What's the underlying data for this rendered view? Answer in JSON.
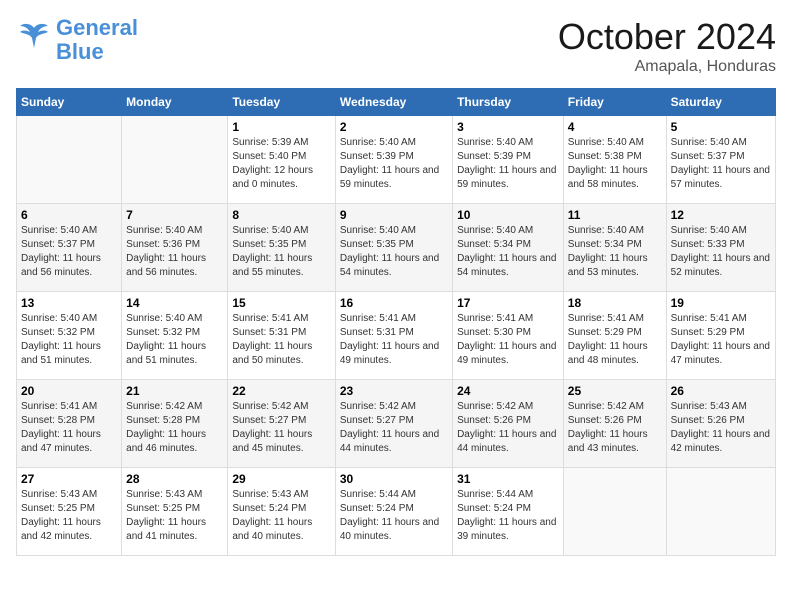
{
  "logo": {
    "line1": "General",
    "line2": "Blue"
  },
  "title": "October 2024",
  "location": "Amapala, Honduras",
  "days_of_week": [
    "Sunday",
    "Monday",
    "Tuesday",
    "Wednesday",
    "Thursday",
    "Friday",
    "Saturday"
  ],
  "weeks": [
    [
      {
        "day": "",
        "sunrise": "",
        "sunset": "",
        "daylight": ""
      },
      {
        "day": "",
        "sunrise": "",
        "sunset": "",
        "daylight": ""
      },
      {
        "day": "1",
        "sunrise": "Sunrise: 5:39 AM",
        "sunset": "Sunset: 5:40 PM",
        "daylight": "Daylight: 12 hours and 0 minutes."
      },
      {
        "day": "2",
        "sunrise": "Sunrise: 5:40 AM",
        "sunset": "Sunset: 5:39 PM",
        "daylight": "Daylight: 11 hours and 59 minutes."
      },
      {
        "day": "3",
        "sunrise": "Sunrise: 5:40 AM",
        "sunset": "Sunset: 5:39 PM",
        "daylight": "Daylight: 11 hours and 59 minutes."
      },
      {
        "day": "4",
        "sunrise": "Sunrise: 5:40 AM",
        "sunset": "Sunset: 5:38 PM",
        "daylight": "Daylight: 11 hours and 58 minutes."
      },
      {
        "day": "5",
        "sunrise": "Sunrise: 5:40 AM",
        "sunset": "Sunset: 5:37 PM",
        "daylight": "Daylight: 11 hours and 57 minutes."
      }
    ],
    [
      {
        "day": "6",
        "sunrise": "Sunrise: 5:40 AM",
        "sunset": "Sunset: 5:37 PM",
        "daylight": "Daylight: 11 hours and 56 minutes."
      },
      {
        "day": "7",
        "sunrise": "Sunrise: 5:40 AM",
        "sunset": "Sunset: 5:36 PM",
        "daylight": "Daylight: 11 hours and 56 minutes."
      },
      {
        "day": "8",
        "sunrise": "Sunrise: 5:40 AM",
        "sunset": "Sunset: 5:35 PM",
        "daylight": "Daylight: 11 hours and 55 minutes."
      },
      {
        "day": "9",
        "sunrise": "Sunrise: 5:40 AM",
        "sunset": "Sunset: 5:35 PM",
        "daylight": "Daylight: 11 hours and 54 minutes."
      },
      {
        "day": "10",
        "sunrise": "Sunrise: 5:40 AM",
        "sunset": "Sunset: 5:34 PM",
        "daylight": "Daylight: 11 hours and 54 minutes."
      },
      {
        "day": "11",
        "sunrise": "Sunrise: 5:40 AM",
        "sunset": "Sunset: 5:34 PM",
        "daylight": "Daylight: 11 hours and 53 minutes."
      },
      {
        "day": "12",
        "sunrise": "Sunrise: 5:40 AM",
        "sunset": "Sunset: 5:33 PM",
        "daylight": "Daylight: 11 hours and 52 minutes."
      }
    ],
    [
      {
        "day": "13",
        "sunrise": "Sunrise: 5:40 AM",
        "sunset": "Sunset: 5:32 PM",
        "daylight": "Daylight: 11 hours and 51 minutes."
      },
      {
        "day": "14",
        "sunrise": "Sunrise: 5:40 AM",
        "sunset": "Sunset: 5:32 PM",
        "daylight": "Daylight: 11 hours and 51 minutes."
      },
      {
        "day": "15",
        "sunrise": "Sunrise: 5:41 AM",
        "sunset": "Sunset: 5:31 PM",
        "daylight": "Daylight: 11 hours and 50 minutes."
      },
      {
        "day": "16",
        "sunrise": "Sunrise: 5:41 AM",
        "sunset": "Sunset: 5:31 PM",
        "daylight": "Daylight: 11 hours and 49 minutes."
      },
      {
        "day": "17",
        "sunrise": "Sunrise: 5:41 AM",
        "sunset": "Sunset: 5:30 PM",
        "daylight": "Daylight: 11 hours and 49 minutes."
      },
      {
        "day": "18",
        "sunrise": "Sunrise: 5:41 AM",
        "sunset": "Sunset: 5:29 PM",
        "daylight": "Daylight: 11 hours and 48 minutes."
      },
      {
        "day": "19",
        "sunrise": "Sunrise: 5:41 AM",
        "sunset": "Sunset: 5:29 PM",
        "daylight": "Daylight: 11 hours and 47 minutes."
      }
    ],
    [
      {
        "day": "20",
        "sunrise": "Sunrise: 5:41 AM",
        "sunset": "Sunset: 5:28 PM",
        "daylight": "Daylight: 11 hours and 47 minutes."
      },
      {
        "day": "21",
        "sunrise": "Sunrise: 5:42 AM",
        "sunset": "Sunset: 5:28 PM",
        "daylight": "Daylight: 11 hours and 46 minutes."
      },
      {
        "day": "22",
        "sunrise": "Sunrise: 5:42 AM",
        "sunset": "Sunset: 5:27 PM",
        "daylight": "Daylight: 11 hours and 45 minutes."
      },
      {
        "day": "23",
        "sunrise": "Sunrise: 5:42 AM",
        "sunset": "Sunset: 5:27 PM",
        "daylight": "Daylight: 11 hours and 44 minutes."
      },
      {
        "day": "24",
        "sunrise": "Sunrise: 5:42 AM",
        "sunset": "Sunset: 5:26 PM",
        "daylight": "Daylight: 11 hours and 44 minutes."
      },
      {
        "day": "25",
        "sunrise": "Sunrise: 5:42 AM",
        "sunset": "Sunset: 5:26 PM",
        "daylight": "Daylight: 11 hours and 43 minutes."
      },
      {
        "day": "26",
        "sunrise": "Sunrise: 5:43 AM",
        "sunset": "Sunset: 5:26 PM",
        "daylight": "Daylight: 11 hours and 42 minutes."
      }
    ],
    [
      {
        "day": "27",
        "sunrise": "Sunrise: 5:43 AM",
        "sunset": "Sunset: 5:25 PM",
        "daylight": "Daylight: 11 hours and 42 minutes."
      },
      {
        "day": "28",
        "sunrise": "Sunrise: 5:43 AM",
        "sunset": "Sunset: 5:25 PM",
        "daylight": "Daylight: 11 hours and 41 minutes."
      },
      {
        "day": "29",
        "sunrise": "Sunrise: 5:43 AM",
        "sunset": "Sunset: 5:24 PM",
        "daylight": "Daylight: 11 hours and 40 minutes."
      },
      {
        "day": "30",
        "sunrise": "Sunrise: 5:44 AM",
        "sunset": "Sunset: 5:24 PM",
        "daylight": "Daylight: 11 hours and 40 minutes."
      },
      {
        "day": "31",
        "sunrise": "Sunrise: 5:44 AM",
        "sunset": "Sunset: 5:24 PM",
        "daylight": "Daylight: 11 hours and 39 minutes."
      },
      {
        "day": "",
        "sunrise": "",
        "sunset": "",
        "daylight": ""
      },
      {
        "day": "",
        "sunrise": "",
        "sunset": "",
        "daylight": ""
      }
    ]
  ]
}
